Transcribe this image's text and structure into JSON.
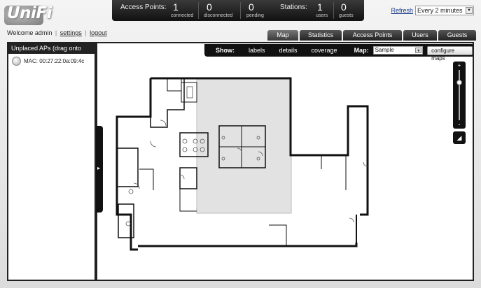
{
  "app": {
    "logo_text": "UniFi"
  },
  "header": {
    "access_points_label": "Access Points:",
    "stations_label": "Stations:",
    "access_points": [
      {
        "value": "1",
        "label": "connected"
      },
      {
        "value": "0",
        "label": "disconnected"
      },
      {
        "value": "0",
        "label": "pending"
      }
    ],
    "stations": [
      {
        "value": "1",
        "label": "users"
      },
      {
        "value": "0",
        "label": "guests"
      }
    ],
    "refresh_label": "Refresh",
    "refresh_interval": "Every 2 minutes"
  },
  "user": {
    "welcome": "Welcome admin",
    "settings_label": "settings",
    "logout_label": "logout"
  },
  "tabs": [
    "Map",
    "Statistics",
    "Access Points",
    "Users",
    "Guests"
  ],
  "active_tab": "Map",
  "left_panel": {
    "header": "Unplaced APs (drag onto map)",
    "items": [
      {
        "mac": "MAC: 00:27:22:0a:09:4c"
      }
    ]
  },
  "map_toolbar": {
    "show_label": "Show:",
    "options": [
      "labels",
      "details",
      "coverage"
    ],
    "map_label": "Map:",
    "map_value": "Sample",
    "configure_label": "configure maps"
  },
  "zoom": {
    "plus": "+",
    "minus": "-",
    "level": 0.75
  },
  "colors": {
    "accent": "#111111",
    "link": "#1a3a8a",
    "floor_fill": "#e2e2e2"
  }
}
